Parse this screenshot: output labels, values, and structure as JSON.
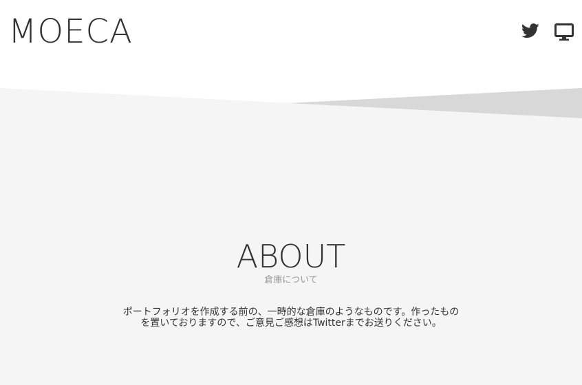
{
  "header": {
    "logo": "MOECA",
    "icons": [
      {
        "name": "twitter-icon"
      },
      {
        "name": "monitor-icon"
      }
    ]
  },
  "about": {
    "title": "ABOUT",
    "subtitle": "倉庫について",
    "text": "ポートフォリオを作成する前の、一時的な倉庫のようなものです。作ったものを置いておりますので、ご意見ご感想はTwitterまでお送りください。"
  },
  "colors": {
    "background": "#ffffff",
    "section_bg": "#f5f5f5",
    "accent_shape": "#d8d8d8",
    "text": "#333333",
    "subtext": "#999999"
  }
}
